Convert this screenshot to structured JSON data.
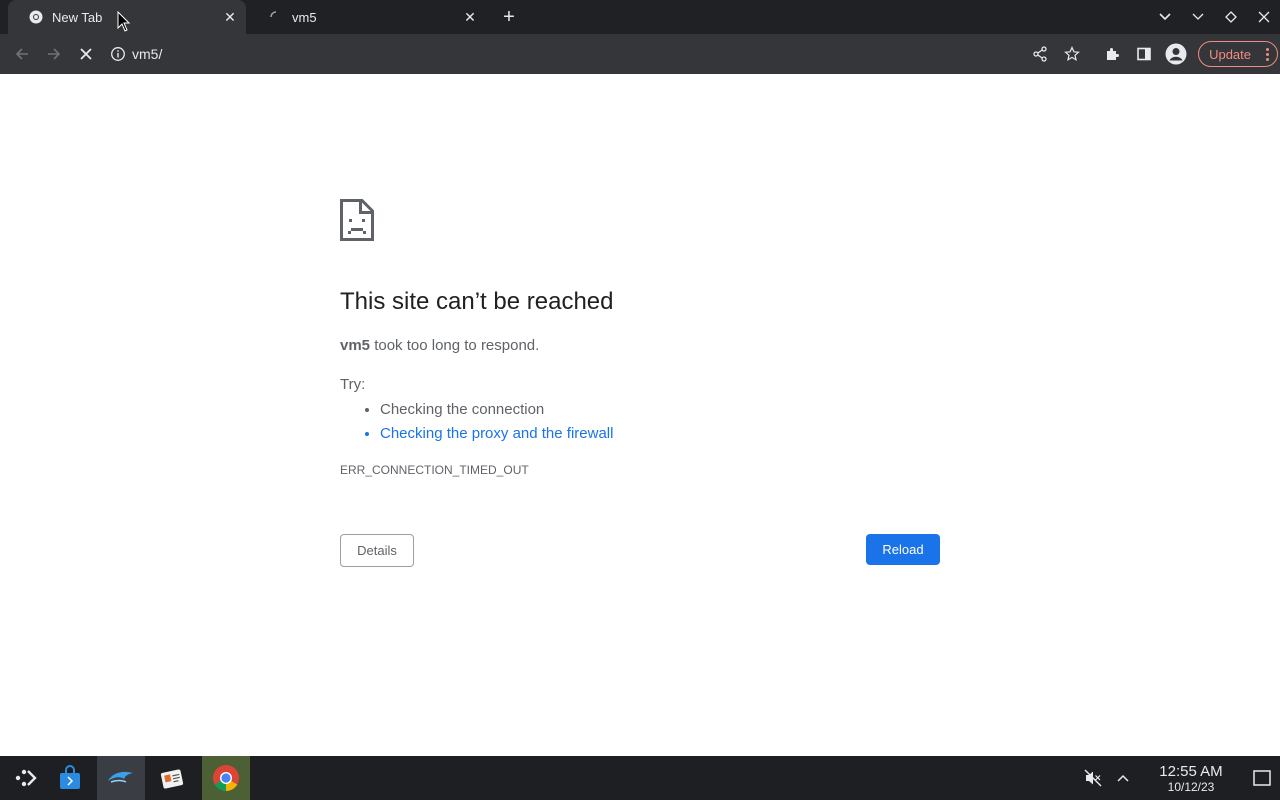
{
  "tabs": [
    {
      "title": "New Tab",
      "state": "active"
    },
    {
      "title": "vm5",
      "state": "loading"
    }
  ],
  "toolbar": {
    "url": "vm5/",
    "update_label": "Update"
  },
  "error_page": {
    "title": "This site can’t be reached",
    "host": "vm5",
    "description_rest": " took too long to respond.",
    "try_label": "Try:",
    "suggestions": [
      "Checking the connection",
      "Checking the proxy and the firewall"
    ],
    "error_code": "ERR_CONNECTION_TIMED_OUT",
    "details_label": "Details",
    "reload_label": "Reload"
  },
  "taskbar": {
    "time": "12:55 AM",
    "date": "10/12/23",
    "apps": [
      "app-launcher-icon",
      "store-icon",
      "dolphin-icon",
      "contacts-icon",
      "chrome-icon"
    ]
  },
  "colors": {
    "accent": "#1a73e8",
    "update": "#f28b82",
    "tabstrip": "#202124",
    "toolbar": "#35363a"
  }
}
